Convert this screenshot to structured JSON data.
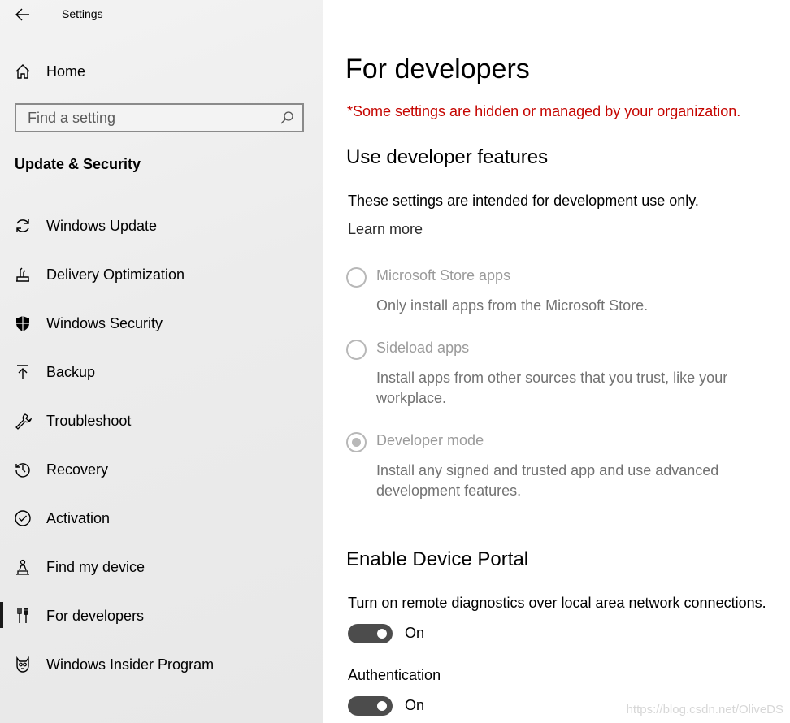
{
  "window": {
    "title": "Settings"
  },
  "sidebar": {
    "home_label": "Home",
    "search_placeholder": "Find a setting",
    "section_label": "Update & Security",
    "items": [
      {
        "label": "Windows Update",
        "icon": "sync-icon"
      },
      {
        "label": "Delivery Optimization",
        "icon": "delivery-optimization-icon"
      },
      {
        "label": "Windows Security",
        "icon": "shield-icon"
      },
      {
        "label": "Backup",
        "icon": "backup-upload-icon"
      },
      {
        "label": "Troubleshoot",
        "icon": "wrench-icon"
      },
      {
        "label": "Recovery",
        "icon": "recovery-history-icon"
      },
      {
        "label": "Activation",
        "icon": "check-circle-icon"
      },
      {
        "label": "Find my device",
        "icon": "find-device-person-icon"
      },
      {
        "label": "For developers",
        "icon": "developer-tools-icon",
        "selected": true
      },
      {
        "label": "Windows Insider Program",
        "icon": "insider-cat-icon"
      }
    ]
  },
  "main": {
    "title": "For developers",
    "org_note": "*Some settings are hidden or managed by your organization.",
    "dev_features": {
      "heading": "Use developer features",
      "description": "These settings are intended for development use only.",
      "learn_more": "Learn more",
      "options": [
        {
          "label": "Microsoft Store apps",
          "description": "Only install apps from the Microsoft Store.",
          "checked": false
        },
        {
          "label": "Sideload apps",
          "description": "Install apps from other sources that you trust, like your workplace.",
          "checked": false
        },
        {
          "label": "Developer mode",
          "description": "Install any signed and trusted app and use advanced development features.",
          "checked": true
        }
      ]
    },
    "device_portal": {
      "heading": "Enable Device Portal",
      "description": "Turn on remote diagnostics over local area network connections.",
      "toggle_state": "On",
      "auth_label": "Authentication",
      "auth_state": "On"
    }
  },
  "watermark": "https://blog.csdn.net/OliveDS"
}
